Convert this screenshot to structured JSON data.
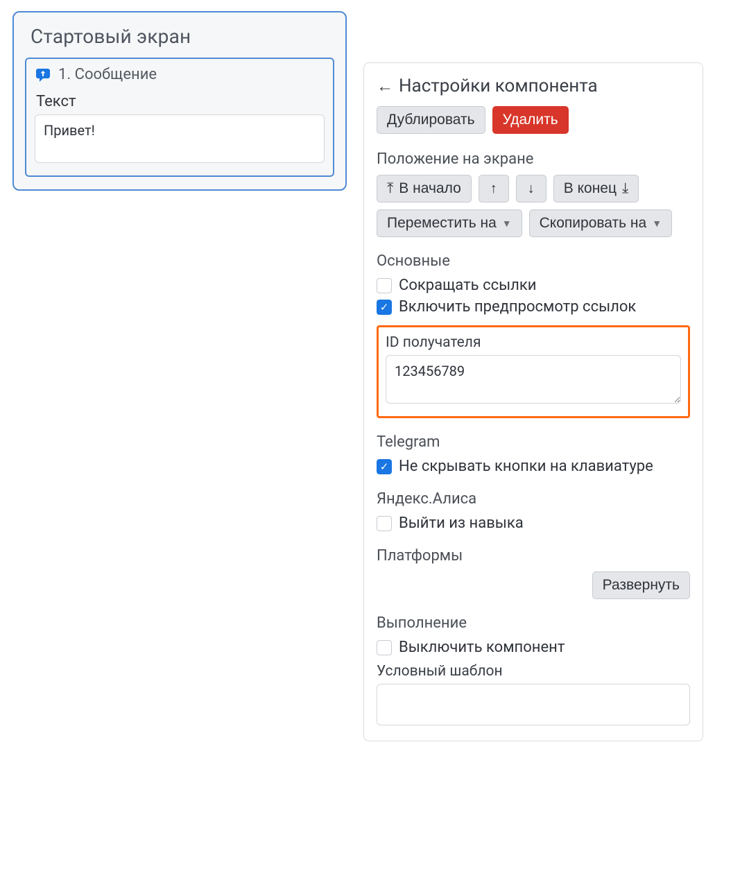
{
  "screen": {
    "title": "Стартовый экран",
    "component": {
      "title": "1. Сообщение",
      "text_label": "Текст",
      "text_value": "Привет!"
    }
  },
  "settings": {
    "title": "Настройки компонента",
    "duplicate": "Дублировать",
    "delete": "Удалить",
    "position_heading": "Положение на экране",
    "to_start": "В начало",
    "to_end": "В конец",
    "move_to": "Переместить на",
    "copy_to": "Скопировать на",
    "main_heading": "Основные",
    "shorten_links": "Сокращать ссылки",
    "enable_preview": "Включить предпросмотр ссылок",
    "recipient_id_label": "ID получателя",
    "recipient_id_value": "123456789",
    "telegram_heading": "Telegram",
    "keep_keyboard": "Не скрывать кнопки на клавиатуре",
    "alice_heading": "Яндекс.Алиса",
    "exit_skill": "Выйти из навыка",
    "platforms_heading": "Платформы",
    "expand": "Развернуть",
    "execution_heading": "Выполнение",
    "disable_component": "Выключить компонент",
    "conditional_template": "Условный шаблон"
  },
  "checks": {
    "shorten_links": false,
    "enable_preview": true,
    "keep_keyboard": true,
    "exit_skill": false,
    "disable_component": false
  }
}
